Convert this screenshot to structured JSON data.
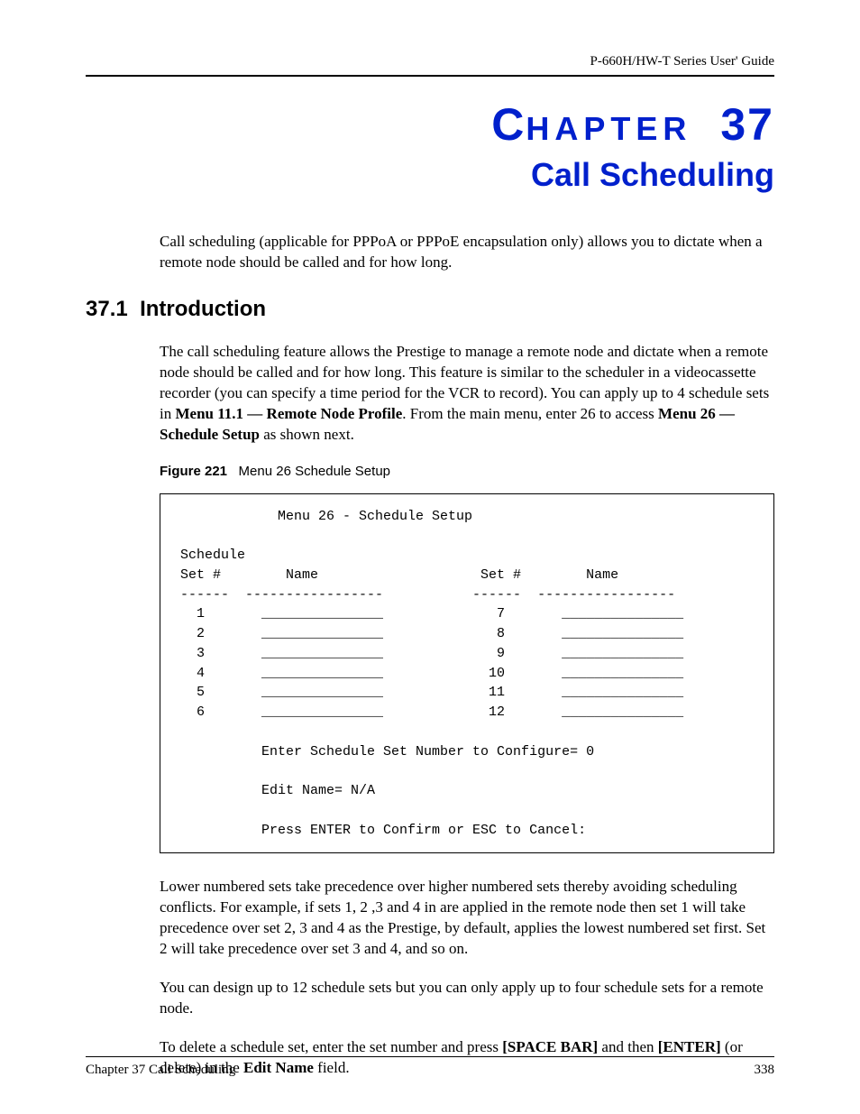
{
  "header": {
    "guide": "P-660H/HW-T Series User' Guide"
  },
  "chapter": {
    "word_prefix": "C",
    "word_rest": "HAPTER",
    "number": "37",
    "title": "Call Scheduling"
  },
  "intro_paragraph": "Call scheduling (applicable for PPPoA or PPPoE encapsulation only) allows you to dictate when a remote node should be called and for how long.",
  "section": {
    "number": "37.1",
    "title": "Introduction"
  },
  "section_paragraph": {
    "pre": "The call scheduling feature allows the Prestige to manage a remote node and dictate when a remote node should be called and for how long. This feature is similar to the scheduler in a videocassette recorder (you can specify a time period for the VCR to record). You can apply up to 4 schedule sets in ",
    "bold1": "Menu 11.1 — Remote Node Profile",
    "mid": ".  From the main menu, enter 26 to access ",
    "bold2": "Menu 26 — Schedule Setup",
    "post": " as shown next."
  },
  "figure": {
    "label": "Figure 221",
    "caption": "Menu 26 Schedule Setup"
  },
  "terminal": {
    "title": "Menu 26 - Schedule Setup",
    "col_label_schedule": "Schedule",
    "col_label_set": "Set #",
    "col_label_name": "Name",
    "rows_left": [
      "1",
      "2",
      "3",
      "4",
      "5",
      "6"
    ],
    "rows_right": [
      "7",
      "8",
      "9",
      "10",
      "11",
      "12"
    ],
    "blank": "_______________",
    "sep_short": "------",
    "sep_long": "-----------------",
    "prompt_configure": "Enter Schedule Set Number to Configure= 0",
    "prompt_edit": "Edit Name= N/A",
    "prompt_confirm": "Press ENTER to Confirm or ESC to Cancel:"
  },
  "para2": "Lower numbered sets take precedence over higher numbered sets thereby avoiding scheduling conflicts. For example, if sets 1, 2 ,3 and 4 in are applied in the remote node then set 1 will take precedence over set 2, 3 and 4 as the Prestige, by default, applies the lowest numbered set first.  Set 2 will take precedence over set 3 and 4, and so on.",
  "para3": "You can design up to 12 schedule sets but you can only apply up to four schedule sets for a remote node.",
  "para4": {
    "pre": "To delete a schedule set, enter the set number and press ",
    "b1": "[SPACE BAR]",
    "mid1": " and then ",
    "b2": "[ENTER]",
    "mid2": " (or delete) in the ",
    "b3": "Edit Name",
    "post": " field."
  },
  "footer": {
    "left": "Chapter 37 Call Scheduling",
    "right": "338"
  }
}
